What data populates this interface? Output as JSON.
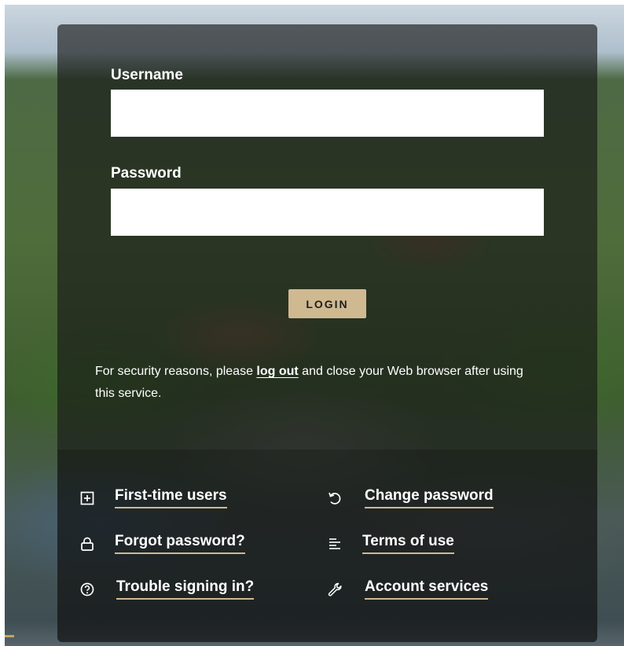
{
  "form": {
    "username_label": "Username",
    "username_value": "",
    "password_label": "Password",
    "password_value": "",
    "login_label": "LOGIN"
  },
  "notice": {
    "text_before": "For security reasons, please ",
    "link_text": "log out",
    "text_after": " and close your Web browser after using this service."
  },
  "links": {
    "first_time_users": "First-time users",
    "change_password": "Change password",
    "forgot_password": "Forgot password?",
    "terms_of_use": "Terms of use",
    "trouble_signing_in": "Trouble signing in?",
    "account_services": "Account services"
  },
  "colors": {
    "accent_gold": "#cfb991",
    "panel_overlay": "rgba(22,22,22,0.64)"
  },
  "icons": {
    "first_time_users": "plus-square-icon",
    "change_password": "rotate-ccw-icon",
    "forgot_password": "lock-icon",
    "terms_of_use": "text-align-icon",
    "trouble_signing_in": "question-circle-icon",
    "account_services": "wrench-icon"
  }
}
